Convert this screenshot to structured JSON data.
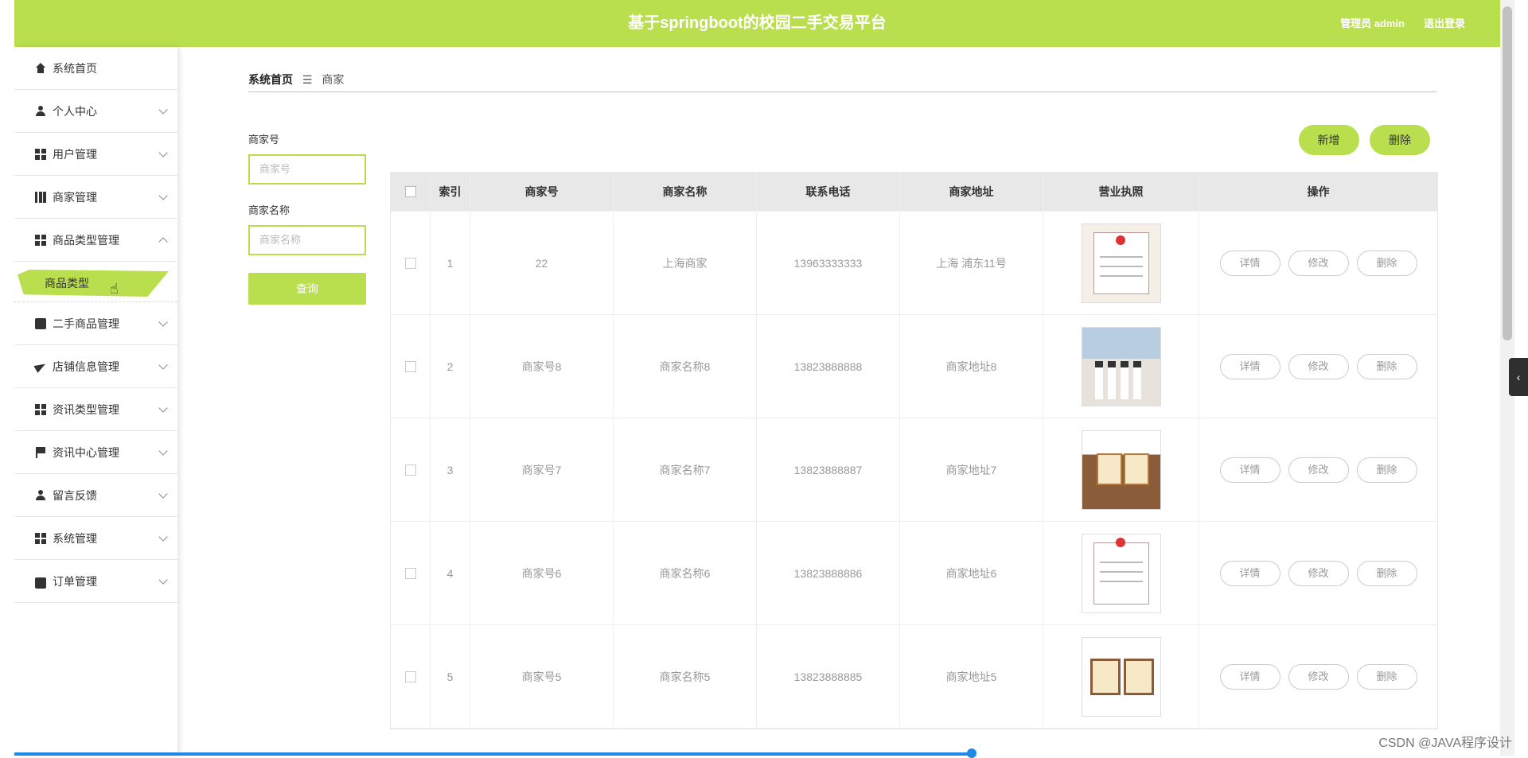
{
  "header": {
    "title": "基于springboot的校园二手交易平台",
    "admin_label": "管理员 admin",
    "logout_label": "退出登录"
  },
  "sidebar": {
    "items": [
      {
        "label": "系统首页",
        "icon": "home-icon"
      },
      {
        "label": "个人中心",
        "icon": "user-icon"
      },
      {
        "label": "用户管理",
        "icon": "grid-icon"
      },
      {
        "label": "商家管理",
        "icon": "book-icon"
      },
      {
        "label": "商品类型管理",
        "icon": "grid-icon"
      },
      {
        "label": "二手商品管理",
        "icon": "chat-icon"
      },
      {
        "label": "店铺信息管理",
        "icon": "send-icon"
      },
      {
        "label": "资讯类型管理",
        "icon": "grid-icon"
      },
      {
        "label": "资讯中心管理",
        "icon": "flag-icon"
      },
      {
        "label": "留言反馈",
        "icon": "user-icon"
      },
      {
        "label": "系统管理",
        "icon": "grid-icon"
      },
      {
        "label": "订单管理",
        "icon": "wallet-icon"
      }
    ],
    "submenu_active": "商品类型"
  },
  "breadcrumb": {
    "home": "系统首页",
    "separator": "☰",
    "current": "商家"
  },
  "search": {
    "field1_label": "商家号",
    "field1_placeholder": "商家号",
    "field2_label": "商家名称",
    "field2_placeholder": "商家名称",
    "query_label": "查询"
  },
  "actions": {
    "add_label": "新增",
    "delete_label": "删除"
  },
  "table": {
    "headers": [
      "索引",
      "商家号",
      "商家名称",
      "联系电话",
      "商家地址",
      "营业执照",
      "操作"
    ],
    "rows": [
      {
        "index": "1",
        "no": "22",
        "name": "上海商家",
        "tel": "13963333333",
        "addr": "上海 浦东11号"
      },
      {
        "index": "2",
        "no": "商家号8",
        "name": "商家名称8",
        "tel": "13823888888",
        "addr": "商家地址8"
      },
      {
        "index": "3",
        "no": "商家号7",
        "name": "商家名称7",
        "tel": "13823888887",
        "addr": "商家地址7"
      },
      {
        "index": "4",
        "no": "商家号6",
        "name": "商家名称6",
        "tel": "13823888886",
        "addr": "商家地址6"
      },
      {
        "index": "5",
        "no": "商家号5",
        "name": "商家名称5",
        "tel": "13823888885",
        "addr": "商家地址5"
      }
    ],
    "op_labels": {
      "detail": "详情",
      "edit": "修改",
      "delete": "删除"
    }
  },
  "watermark": "CSDN @JAVA程序设计",
  "colors": {
    "accent": "#b9df4f",
    "progress": "#1e88e5"
  }
}
